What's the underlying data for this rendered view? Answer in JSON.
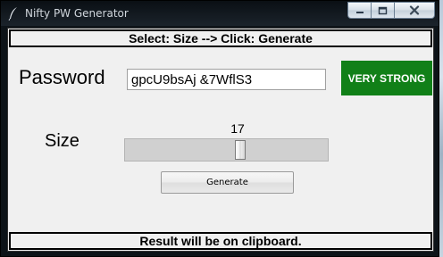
{
  "window": {
    "title": "Nifty PW Generator"
  },
  "banner_top": "Select: Size --> Click: Generate",
  "password": {
    "label": "Password",
    "value": "gpcU9bsAj &7WflS3"
  },
  "strength": {
    "label": "VERY STRONG",
    "color": "#118018"
  },
  "size": {
    "label": "Size",
    "value": "17",
    "level_fraction": 0.57
  },
  "generate_button": "Generate",
  "banner_bottom": "Result will be on clipboard.",
  "icons": [
    "feather-icon",
    "minimize-icon",
    "maximize-icon",
    "close-icon"
  ]
}
